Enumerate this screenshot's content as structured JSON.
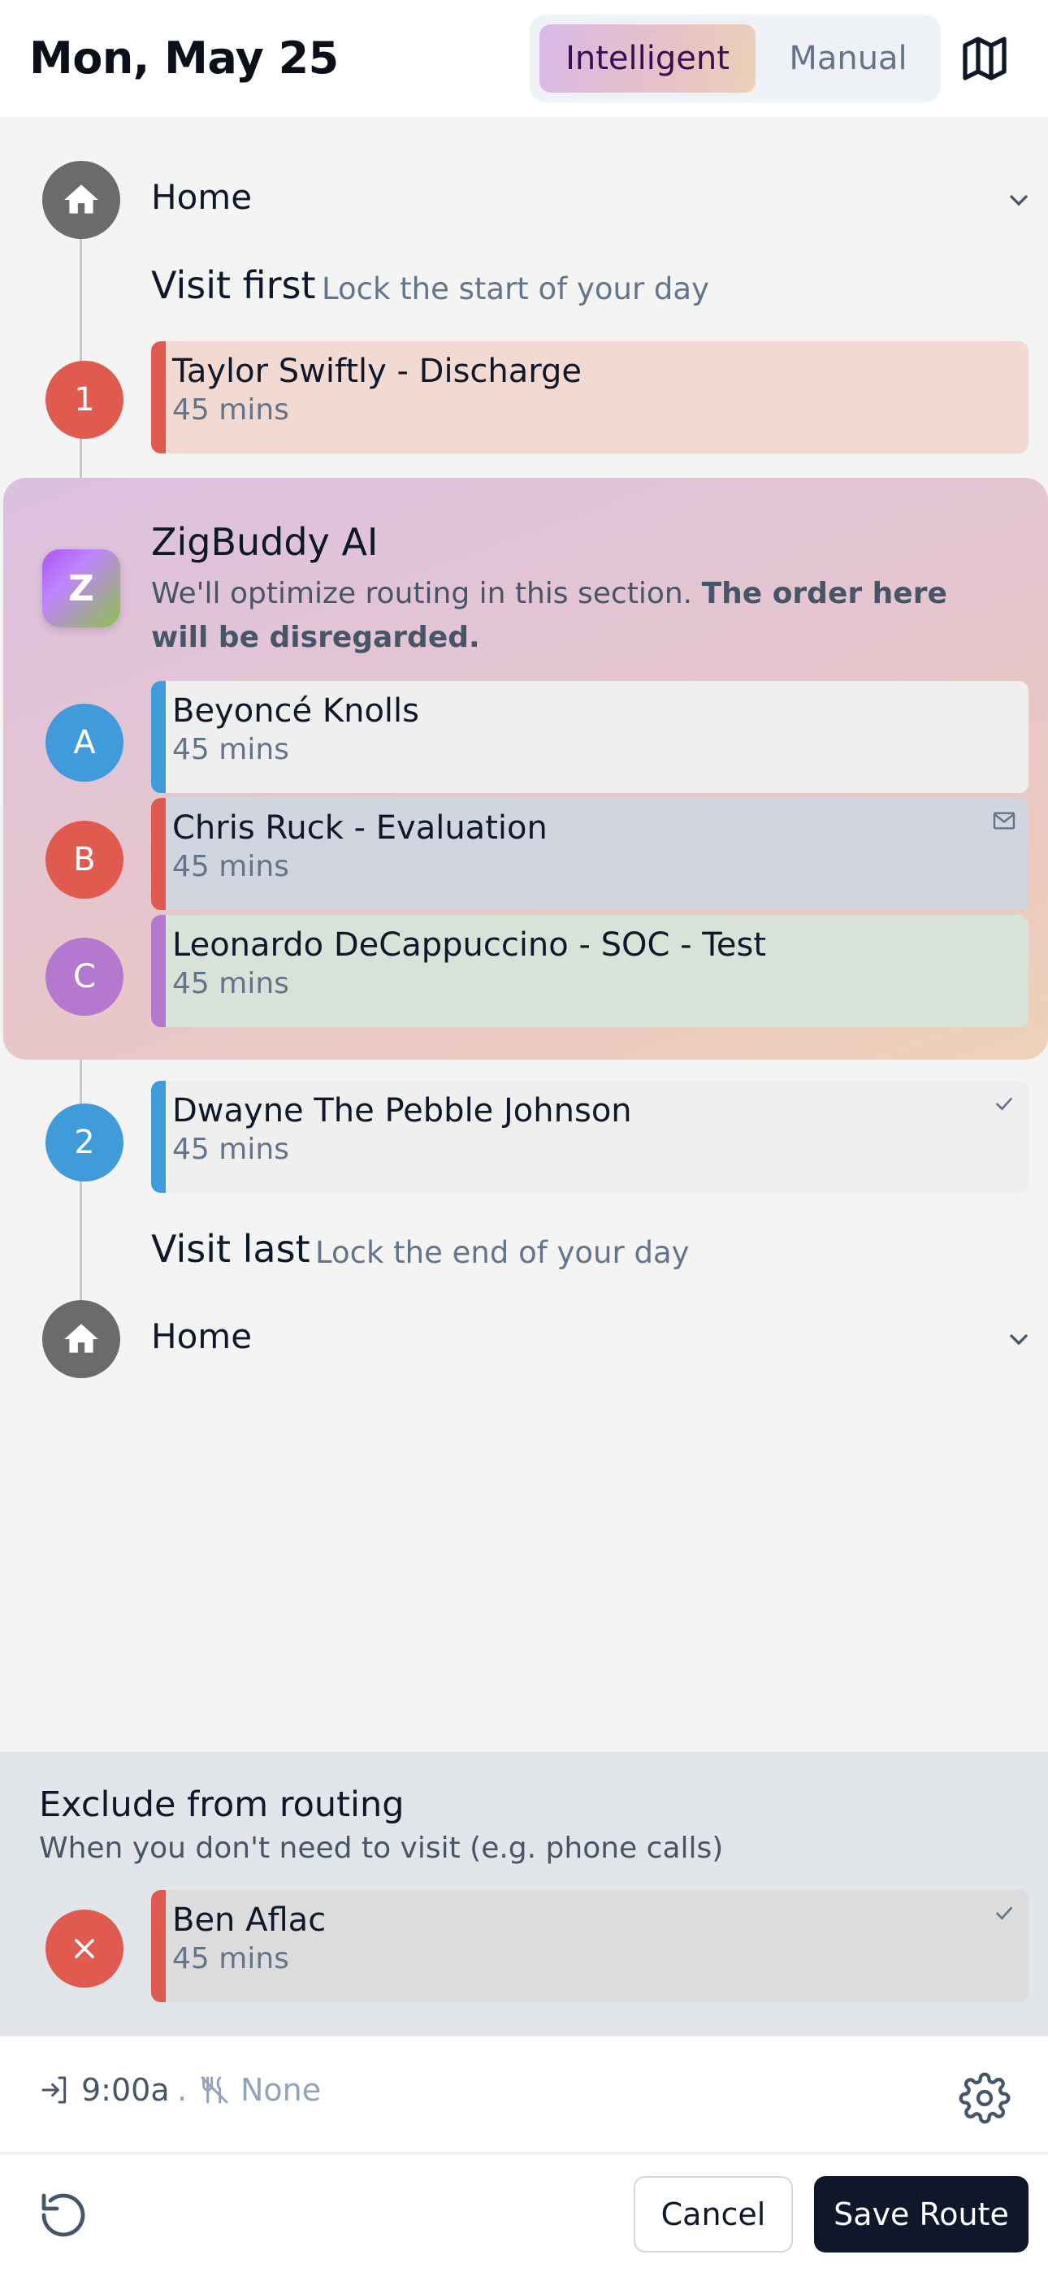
{
  "header": {
    "date": "Mon, May 25",
    "modes": [
      {
        "label": "Intelligent",
        "active": true
      },
      {
        "label": "Manual",
        "active": false
      }
    ],
    "map_icon": "map-icon"
  },
  "route": {
    "start": {
      "label": "Home",
      "icon": "home-icon"
    },
    "visit_first": {
      "title": "Visit first",
      "subtitle": "Lock the start of your day"
    },
    "first_stops": [
      {
        "marker": "1",
        "name": "Taylor Swiftly - Discharge",
        "duration": "45 mins",
        "accent": "#e05a4f"
      }
    ],
    "ai": {
      "badge": "Z",
      "title": "ZigBuddy AI",
      "desc_plain": "We'll optimize routing in this section. ",
      "desc_bold": "The order here will be disregarded.",
      "stops": [
        {
          "marker": "A",
          "name": "Beyoncé Knolls",
          "duration": "45 mins",
          "accent": "#3f9bd9"
        },
        {
          "marker": "B",
          "name": "Chris Ruck - Evaluation",
          "duration": "45 mins",
          "accent": "#e05a4f",
          "corner_icon": "mail-icon"
        },
        {
          "marker": "C",
          "name": "Leonardo DeCappuccino - SOC - Test",
          "duration": "45 mins",
          "accent": "#b578cf"
        }
      ]
    },
    "middle_stops": [
      {
        "marker": "2",
        "name": "Dwayne The Pebble Johnson",
        "duration": "45 mins",
        "accent": "#3f9bd9",
        "corner_icon": "check-icon"
      }
    ],
    "visit_last": {
      "title": "Visit last",
      "subtitle": "Lock the end of your day"
    },
    "end": {
      "label": "Home",
      "icon": "home-icon"
    }
  },
  "exclude": {
    "title": "Exclude from routing",
    "subtitle": "When you don't need to visit (e.g. phone calls)",
    "stops": [
      {
        "name": "Ben Aflac",
        "duration": "45 mins",
        "accent": "#e05a4f",
        "corner_icon": "check-icon"
      }
    ]
  },
  "info": {
    "start_time": "9:00a",
    "separator": ".",
    "lunch": "None"
  },
  "footer": {
    "cancel": "Cancel",
    "save": "Save Route"
  },
  "colors": {
    "red": "#e05a4f",
    "blue": "#3f9bd9",
    "purple": "#b578cf",
    "dark": "#0f172a"
  }
}
